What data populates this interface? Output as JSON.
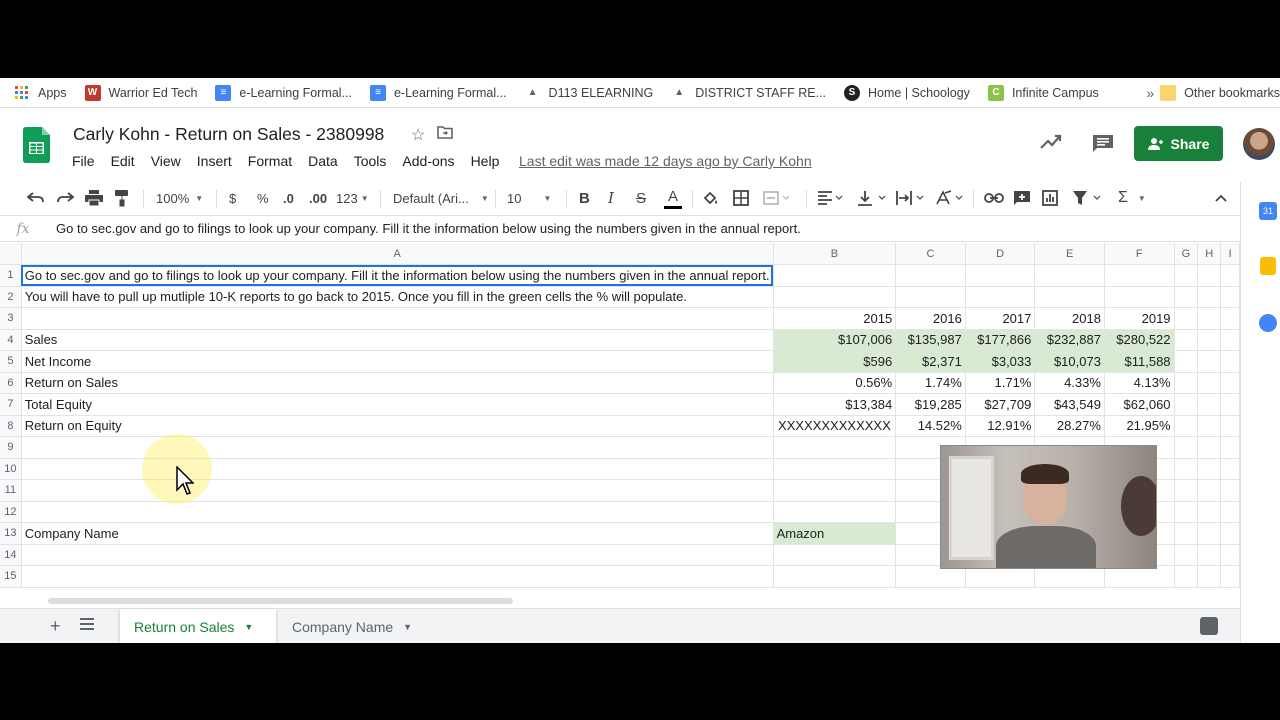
{
  "bookmarks": {
    "items": [
      {
        "label": "Apps",
        "icon": "apps-grid-icon"
      },
      {
        "label": "Warrior Ed Tech",
        "icon": "warrior-icon"
      },
      {
        "label": "e-Learning Formal...",
        "icon": "docs-icon"
      },
      {
        "label": "e-Learning Formal...",
        "icon": "docs-icon"
      },
      {
        "label": "D113 ELEARNING",
        "icon": "mountain-icon"
      },
      {
        "label": "DISTRICT STAFF RE...",
        "icon": "mountain-icon"
      },
      {
        "label": "Home | Schoology",
        "icon": "schoology-icon"
      },
      {
        "label": "Infinite Campus",
        "icon": "campus-icon"
      }
    ],
    "more": "»",
    "other": "Other bookmarks"
  },
  "document": {
    "title": "Carly Kohn - Return on Sales - 2380998",
    "menus": [
      "File",
      "Edit",
      "View",
      "Insert",
      "Format",
      "Data",
      "Tools",
      "Add-ons",
      "Help"
    ],
    "last_edit": "Last edit was made 12 days ago by Carly Kohn",
    "share_label": "Share"
  },
  "toolbar": {
    "zoom": "100%",
    "currency": "$",
    "percent": "%",
    "decrease_decimal": ".0",
    "increase_decimal": ".00",
    "more_formats": "123",
    "font": "Default (Ari...",
    "font_size": "10",
    "bold": "B",
    "italic": "I",
    "strike": "S",
    "text_color": "A",
    "sum": "Σ"
  },
  "formula_bar": {
    "fx": "fx",
    "content": "Go to sec.gov and go to filings to look up your company.  Fill it the information below using the numbers given in the annual report."
  },
  "grid": {
    "columns": [
      "A",
      "B",
      "C",
      "D",
      "E",
      "F",
      "G",
      "H",
      "I"
    ],
    "rows": [
      {
        "n": "1",
        "cells": [
          "Go to sec.gov and go to filings to look up your company.  Fill it the information below using the numbers given in the annual report.",
          "",
          "",
          "",
          "",
          "",
          "",
          "",
          ""
        ]
      },
      {
        "n": "2",
        "cells": [
          "You will have to pull up mutliple 10-K reports to go back to 2015.  Once you fill in the green cells the % will populate.",
          "",
          "",
          "",
          "",
          "",
          "",
          "",
          ""
        ]
      },
      {
        "n": "3",
        "cells": [
          "",
          "2015",
          "2016",
          "2017",
          "2018",
          "2019",
          "",
          "",
          ""
        ]
      },
      {
        "n": "4",
        "cells": [
          "Sales",
          "$107,006",
          "$135,987",
          "$177,866",
          "$232,887",
          "$280,522",
          "",
          "",
          ""
        ]
      },
      {
        "n": "5",
        "cells": [
          "Net Income",
          "$596",
          "$2,371",
          "$3,033",
          "$10,073",
          "$11,588",
          "",
          "",
          ""
        ]
      },
      {
        "n": "6",
        "cells": [
          "Return on Sales",
          "0.56%",
          "1.74%",
          "1.71%",
          "4.33%",
          "4.13%",
          "",
          "",
          ""
        ]
      },
      {
        "n": "7",
        "cells": [
          "Total Equity",
          "$13,384",
          "$19,285",
          "$27,709",
          "$43,549",
          "$62,060",
          "",
          "",
          ""
        ]
      },
      {
        "n": "8",
        "cells": [
          "Return on Equity",
          "XXXXXXXXXXXXX",
          "14.52%",
          "12.91%",
          "28.27%",
          "21.95%",
          "",
          "",
          ""
        ]
      },
      {
        "n": "9",
        "cells": [
          "",
          "",
          "",
          "",
          "",
          "",
          "",
          "",
          ""
        ]
      },
      {
        "n": "10",
        "cells": [
          "",
          "",
          "",
          "",
          "",
          "",
          "",
          "",
          ""
        ]
      },
      {
        "n": "11",
        "cells": [
          "",
          "",
          "",
          "",
          "",
          "",
          "",
          "",
          ""
        ]
      },
      {
        "n": "12",
        "cells": [
          "",
          "",
          "",
          "",
          "",
          "",
          "",
          "",
          ""
        ]
      },
      {
        "n": "13",
        "cells": [
          "Company Name",
          "Amazon",
          "",
          "",
          "",
          "",
          "",
          "",
          ""
        ]
      },
      {
        "n": "14",
        "cells": [
          "",
          "",
          "",
          "",
          "",
          "",
          "",
          "",
          ""
        ]
      },
      {
        "n": "15",
        "cells": [
          "",
          "",
          "",
          "",
          "",
          "",
          "",
          "",
          ""
        ]
      }
    ]
  },
  "sheet_tabs": [
    {
      "label": "Return on Sales",
      "active": true
    },
    {
      "label": "Company Name",
      "active": false
    }
  ],
  "colors": {
    "share_green": "#188038",
    "input_cell_green": "#d9ead3",
    "selection_blue": "#1a73e8"
  }
}
